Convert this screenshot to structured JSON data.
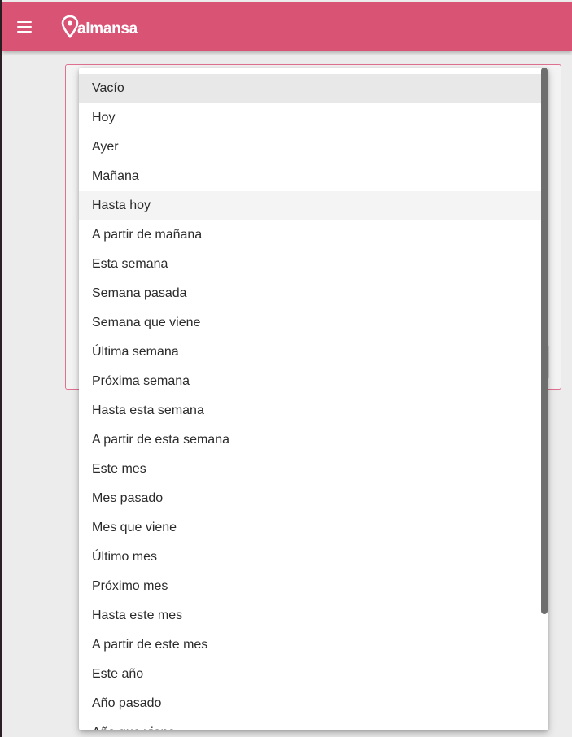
{
  "header": {
    "logo_text": "almansa",
    "menu_icon": "hamburger-menu-icon",
    "background_color": "#d95375"
  },
  "dropdown": {
    "selected_index": 0,
    "hovered_index": 4,
    "options": [
      "Vacío",
      "Hoy",
      "Ayer",
      "Mañana",
      "Hasta hoy",
      "A partir de mañana",
      "Esta semana",
      "Semana pasada",
      "Semana que viene",
      "Última semana",
      "Próxima semana",
      "Hasta esta semana",
      "A partir de esta semana",
      "Este mes",
      "Mes pasado",
      "Mes que viene",
      "Último mes",
      "Próximo mes",
      "Hasta este mes",
      "A partir de este mes",
      "Este año",
      "Año pasado",
      "Año que viene"
    ]
  },
  "colors": {
    "accent": "#d95375",
    "card_border": "#e07090",
    "selected_bg": "#e8e8e8"
  }
}
